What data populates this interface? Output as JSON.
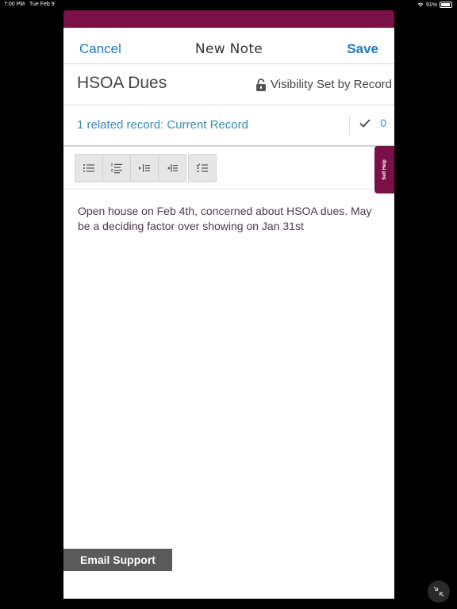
{
  "status_bar": {
    "time": "7:00 PM",
    "date": "Tue Feb 9",
    "battery": "91%",
    "battery_level": 0.91,
    "wifi_icon": "wifi-icon"
  },
  "header": {
    "cancel_label": "Cancel",
    "title": "New Note",
    "save_label": "Save",
    "accent_color": "#1a7bbf"
  },
  "note": {
    "title": "HSOA Dues",
    "visibility_label": "Visibility Set by Record",
    "visibility_icon": "lock-icon",
    "body": "Open house on Feb 4th, concerned about HSOA dues. May be a deciding factor over showing on Jan 31st"
  },
  "related": {
    "label": "1 related record: Current Record",
    "count": "0",
    "icon": "checkmark-icon"
  },
  "toolbar": {
    "buttons": [
      {
        "icon": "bulleted-list-icon"
      },
      {
        "icon": "numbered-list-icon"
      },
      {
        "icon": "indent-increase-icon"
      },
      {
        "icon": "indent-decrease-icon"
      },
      {
        "icon": "checklist-icon"
      }
    ]
  },
  "self_help": {
    "label": "Self Help",
    "color": "#7a1046"
  },
  "email_support": {
    "label": "Email Support"
  },
  "collapse_icon": "collapse-arrows-icon"
}
